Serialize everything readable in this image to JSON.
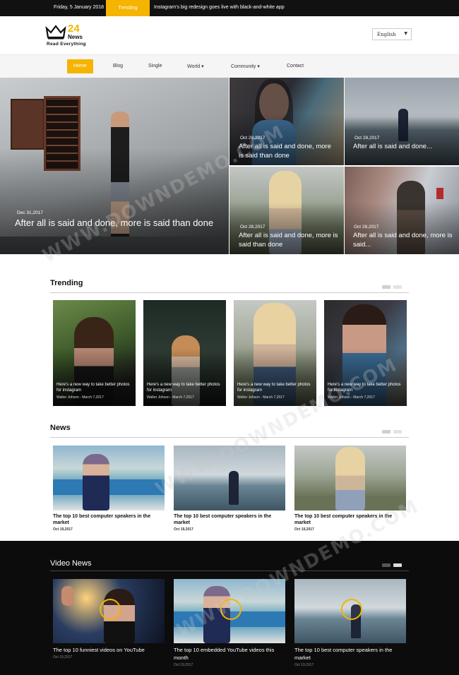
{
  "topbar": {
    "date": "Friday, 5 January 2018",
    "trending_label": "Trending",
    "ticker": "Instagram's big redesign goes live with black-and-white app"
  },
  "header": {
    "logo_number": "24",
    "logo_brand": "News",
    "logo_tagline": "Read Everything",
    "language": "English"
  },
  "nav": {
    "items": [
      "Home",
      "Blog",
      "Single",
      "World ▾",
      "Community ▾",
      "Contact"
    ]
  },
  "hero": [
    {
      "date": "Dec 31,2017",
      "title": "After all is said and done, more is said than done"
    },
    {
      "date": "Oct 28,2017",
      "title": "After all is said and done, more is said than done"
    },
    {
      "date": "Oct 28,2017",
      "title": "After all is said and done..."
    },
    {
      "date": "Oct 28,2017",
      "title": "After all is said and done, more is said than done"
    },
    {
      "date": "Oct 28,2017",
      "title": "After all is said and done, more is said..."
    }
  ],
  "trending": {
    "heading": "Trending",
    "cards": [
      {
        "title": "Here's a new way to take better photos for instagram",
        "meta": "Walter Johson - March 7,2017"
      },
      {
        "title": "Here's a new way to take better photos for instagram",
        "meta": "Walter Johson - March 7,2017"
      },
      {
        "title": "Here's a new way to take better photos for instagram",
        "meta": "Walter Johson - March 7,2017"
      },
      {
        "title": "Here's a new way to take better photos for instagram",
        "meta": "Walter Johson - March 7,2017"
      }
    ]
  },
  "news": {
    "heading": "News",
    "cards": [
      {
        "title": "The top 10 best computer speakers in the market",
        "meta": "Oct 19,2017"
      },
      {
        "title": "The top 10 best computer speakers in the market",
        "meta": "Oct 19,2017"
      },
      {
        "title": "The top 10 best computer speakers in the market",
        "meta": "Oct 19,2017"
      }
    ]
  },
  "video": {
    "heading": "Video News",
    "cards": [
      {
        "title": "The top 10 funniest videos on YouTube",
        "meta": "Oct 19,2017"
      },
      {
        "title": "The top 10 embedded YouTube videos this month",
        "meta": "Oct 19,2017"
      },
      {
        "title": "The top 10 best computer speakers in the market",
        "meta": "Oct 19,2017"
      }
    ]
  },
  "colors": {
    "accent": "#f4b400",
    "dark": "#111111"
  },
  "watermark": "WWW.DOWNDEMO.COM"
}
